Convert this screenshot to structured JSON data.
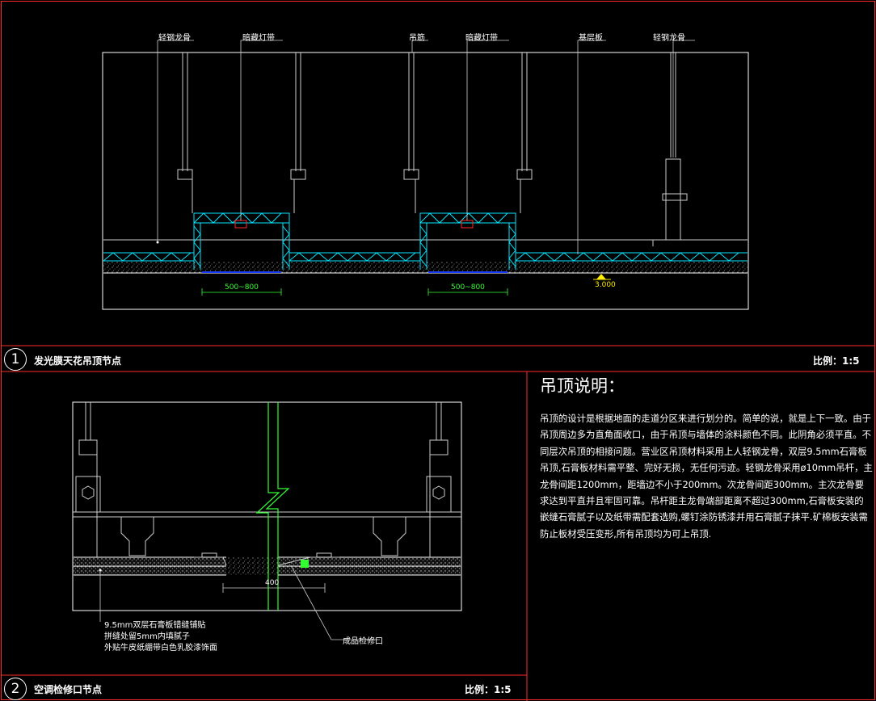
{
  "detail1": {
    "number": "1",
    "title": "发光膜天花吊顶节点",
    "scale": "比例：1:5",
    "labels": [
      "轻钢龙骨",
      "暗藏灯带",
      "吊筋",
      "暗藏灯带",
      "基层板",
      "轻钢龙骨"
    ],
    "dims": [
      "500~800",
      "500~800"
    ],
    "elevation": "3.000"
  },
  "detail2": {
    "number": "2",
    "title": "空调检修口节点",
    "scale": "比例：1:5",
    "dim": "400",
    "note_lines": [
      "9.5mm双层石膏板错缝铺贴",
      "拼缝处留5mm内填腻子",
      "外贴牛皮纸绷带白色乳胶漆饰面"
    ],
    "access_label": "成品检修口"
  },
  "notes": {
    "title": "吊顶说明：",
    "body": "吊顶的设计是根据地面的走道分区来进行划分的。简单的说，就是上下一致。由于吊顶周边多为直角面收口，由于吊顶与墙体的涂料颜色不同。此阴角必须平直。不同层次吊顶的相接问题。营业区吊顶材料采用上人轻钢龙骨，双层9.5mm石膏板吊顶,石膏板材料需平整、完好无损，无任何污迹。轻钢龙骨采用ø10mm吊杆，主龙骨间距1200mm，距墙边不小于200mm。次龙骨间距300mm。主次龙骨要求达到平直并且牢固可靠。吊杆距主龙骨端部距离不超过300mm,石膏板安装的嵌缝石膏腻子以及纸带需配套选购,螺钉涂防锈漆并用石膏腻子抹平.矿棉板安装需防止板材受压变形,所有吊顶均为可上吊顶."
  },
  "colors": {
    "frame": "#ff2a2a",
    "cyan": "#00e5ff",
    "green": "#33ff33",
    "yellow": "#ffee00",
    "blue": "#1a3cff"
  }
}
